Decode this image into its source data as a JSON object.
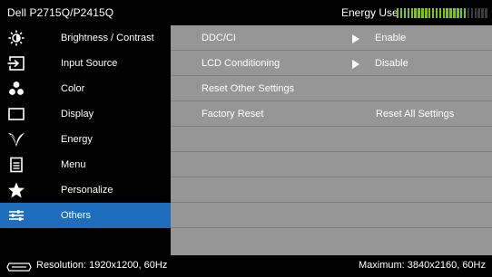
{
  "header": {
    "model": "Dell P2715Q/P2415Q",
    "energy_label": "Energy Use",
    "energy_use_level": 0.75
  },
  "sidebar": {
    "items": [
      {
        "label": "Brightness / Contrast",
        "icon": "brightness-icon"
      },
      {
        "label": "Input Source",
        "icon": "input-source-icon"
      },
      {
        "label": "Color",
        "icon": "color-icon"
      },
      {
        "label": "Display",
        "icon": "display-icon"
      },
      {
        "label": "Energy",
        "icon": "energy-icon"
      },
      {
        "label": "Menu",
        "icon": "menu-icon"
      },
      {
        "label": "Personalize",
        "icon": "star-icon"
      },
      {
        "label": "Others",
        "icon": "others-icon",
        "selected": true
      }
    ]
  },
  "panel": {
    "rows": [
      {
        "label": "DDC/CI",
        "value": "Enable"
      },
      {
        "label": "LCD Conditioning",
        "value": "Disable"
      },
      {
        "label": "Reset Other Settings",
        "value": ""
      },
      {
        "label": "Factory Reset",
        "value": "Reset All Settings"
      }
    ]
  },
  "status": {
    "resolution": "Resolution: 1920x1200, 60Hz",
    "maximum": "Maximum: 3840x2160, 60Hz"
  },
  "colors": {
    "accent": "#1f6ebd",
    "panel": "#969696",
    "meter_on": "#7ac70c",
    "meter_off": "#3a3a3a"
  }
}
